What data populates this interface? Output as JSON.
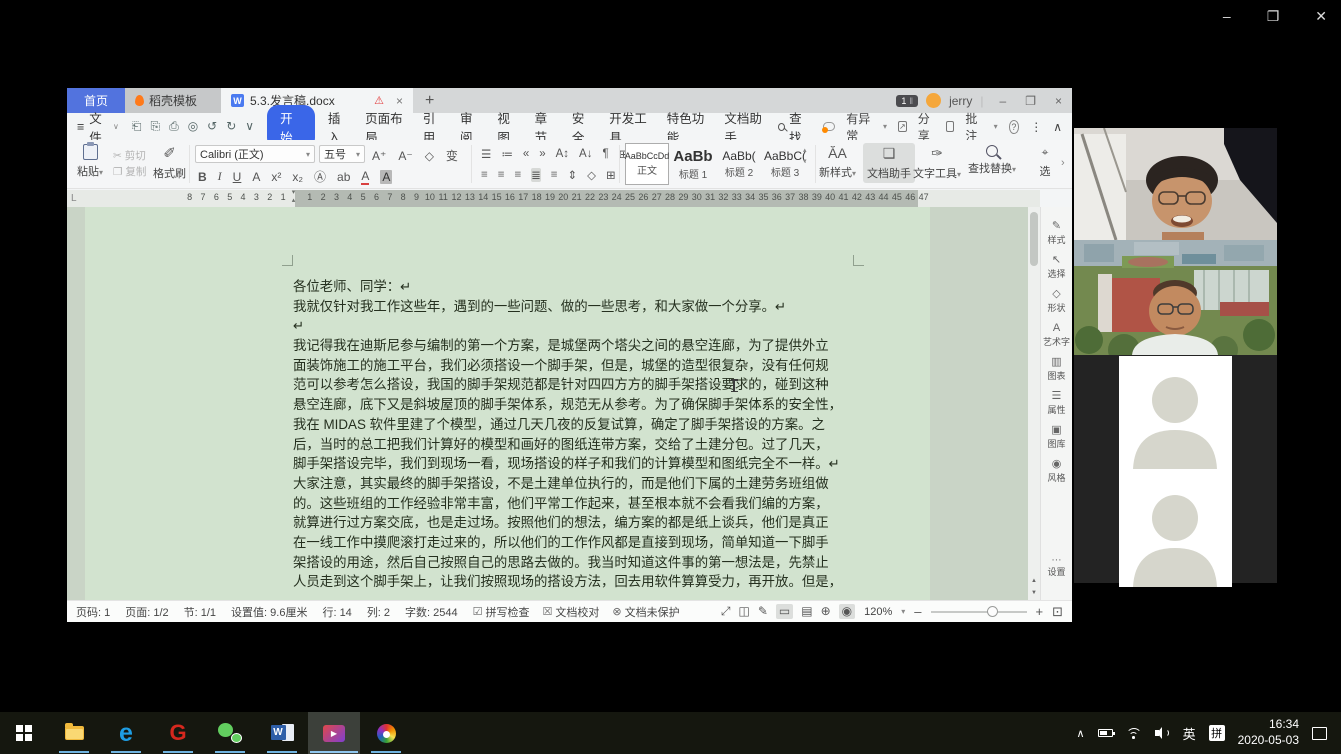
{
  "conference": {
    "controls": {
      "minimize": "–",
      "restore": "❐",
      "close": "✕"
    }
  },
  "ui": {
    "caret": "▾",
    "caret_small": "∨",
    "expand": "›",
    "bars": "‖",
    "play": "▶",
    "dots": "⋯",
    "more": "⋮",
    "collapse": "∧",
    "up": "▴",
    "down": "▾"
  },
  "wps": {
    "tab_bar": {
      "home": "首页",
      "template": "稻壳模板",
      "doc": "5.3.发言稿.docx",
      "warning": "⚠",
      "close_tab": "×",
      "new_tab": "+",
      "window_count": "1",
      "account": "jerry",
      "sep": "|",
      "minimize": "–",
      "restore": "❐",
      "close": "×"
    },
    "menu": {
      "hamburger": "≡",
      "file": "文件",
      "quick_icons": [
        "⎗",
        "⎘",
        "⎙",
        "◎",
        "↺",
        "↻",
        "∨"
      ],
      "home": "开始",
      "items": [
        "插入",
        "页面布局",
        "引用",
        "审阅",
        "视图",
        "章节",
        "安全",
        "开发工具",
        "特色功能",
        "文档助手"
      ],
      "find": "查找",
      "abnormal": "有异常",
      "share": "分享",
      "comment": "批注",
      "help": "?"
    },
    "ribbon": {
      "paste": "粘贴",
      "cut_icon": "✂",
      "cut": "剪切",
      "copy_icon": "❐",
      "copy": "复制",
      "fp_icon": "✐",
      "format_painter": "格式刷",
      "font_name": "Calibri (正文)",
      "font_size": "五号",
      "font_tools": [
        "A⁺",
        "A⁻",
        "◇",
        "变"
      ],
      "font_row": [
        "B",
        "I",
        "U",
        "A",
        "x²",
        "x₂",
        "Ⓐ",
        "ab",
        "A",
        "A"
      ],
      "para_row1": [
        "☰",
        "≔",
        "«",
        "»",
        "A↕",
        "A↓",
        "¶",
        "⊞"
      ],
      "para_row2": [
        "≡",
        "≡",
        "≡",
        "≣",
        "≡",
        "⇕",
        "◇",
        "⊞"
      ],
      "styles": [
        {
          "sample": "AaBbCcDd",
          "name": "正文"
        },
        {
          "sample": "AaBb",
          "name": "标题 1"
        },
        {
          "sample": "AaBb(",
          "name": "标题 2"
        },
        {
          "sample": "AaBbC(",
          "name": "标题 3"
        }
      ],
      "new_style_icon": "ĂA",
      "new_style": "新样式",
      "assistant_icon": "❏",
      "doc_assistant": "文档助手",
      "text_tool_icon": "✑",
      "text_tool": "文字工具",
      "find_replace": "查找替换",
      "select": "选"
    },
    "ruler": {
      "tab_selector": "L",
      "numbers": [
        "8",
        "7",
        "6",
        "5",
        "4",
        "3",
        "2",
        "1",
        "",
        "1",
        "2",
        "3",
        "4",
        "5",
        "6",
        "7",
        "8",
        "9",
        "10",
        "11",
        "12",
        "13",
        "14",
        "15",
        "16",
        "17",
        "18",
        "19",
        "20",
        "21",
        "22",
        "23",
        "24",
        "25",
        "26",
        "27",
        "28",
        "29",
        "30",
        "31",
        "32",
        "33",
        "34",
        "35",
        "36",
        "37",
        "38",
        "39",
        "40",
        "41",
        "42",
        "43",
        "44",
        "45",
        "46",
        "47"
      ]
    },
    "document": {
      "lines": [
        "各位老师、同学：↵",
        "我就仅针对我工作这些年，遇到的一些问题、做的一些思考，和大家做一个分享。↵",
        "↵",
        "我记得我在迪斯尼参与编制的第一个方案，是城堡两个塔尖之间的悬空连廊，为了提供外立",
        "面装饰施工的施工平台，我们必须搭设一个脚手架，但是，城堡的造型很复杂，没有任何规",
        "范可以参考怎么搭设，我国的脚手架规范都是针对四四方方的脚手架搭设要求的，碰到这种",
        "悬空连廊，底下又是斜坡屋顶的脚手架体系，规范无从参考。为了确保脚手架体系的安全性，",
        "我在 MIDAS 软件里建了个模型，通过几天几夜的反复试算，确定了脚手架搭设的方案。之",
        "后，当时的总工把我们计算好的模型和画好的图纸连带方案，交给了土建分包。过了几天，",
        "脚手架搭设完毕，我们到现场一看，现场搭设的样子和我们的计算模型和图纸完全不一样。↵",
        "大家注意，其实最终的脚手架搭设，不是土建单位执行的，而是他们下属的土建劳务班组做",
        "的。这些班组的工作经验非常丰富，他们平常工作起来，甚至根本就不会看我们编的方案，",
        "就算进行过方案交底，也是走过场。按照他们的想法，编方案的都是纸上谈兵，他们是真正",
        "在一线工作中摸爬滚打走过来的，所以他们的工作作风都是直接到现场，简单知道一下脚手",
        "架搭设的用途，然后自己按照自己的思路去做的。我当时知道这件事的第一想法是，先禁止",
        "人员走到这个脚手架上，让我们按照现场的搭设方法，回去用软件算算受力，再开放。但是，"
      ]
    },
    "status_bar": {
      "items": [
        "页码: 1",
        "页面: 1/2",
        "节: 1/1",
        "设置值: 9.6厘米",
        "行: 14",
        "列: 2",
        "字数: 2544"
      ],
      "checks": [
        {
          "icon": "☑",
          "label": "拼写检查"
        },
        {
          "icon": "☒",
          "label": "文档校对"
        },
        {
          "icon": "⊗",
          "label": "文档未保护"
        }
      ],
      "view_icons": [
        "⤢",
        "◫",
        "✎",
        "▭",
        "▤",
        "⊕",
        "◉"
      ],
      "zoom": "120%",
      "zoom_out": "–",
      "zoom_in": "+",
      "fit": "⊡"
    },
    "sidebar": {
      "items": [
        {
          "icon": "✎",
          "label": "样式"
        },
        {
          "icon": "↖",
          "label": "选择"
        },
        {
          "icon": "◇",
          "label": "形状"
        },
        {
          "icon": "A",
          "label": "艺术字"
        },
        {
          "icon": "▥",
          "label": "图表"
        },
        {
          "icon": "☰",
          "label": "属性"
        },
        {
          "icon": "▣",
          "label": "图库"
        },
        {
          "icon": "◉",
          "label": "风格"
        }
      ],
      "settings": "设置"
    }
  },
  "taskbar": {
    "glyphs": {
      "edge": "e",
      "g": "G",
      "word": "W"
    },
    "tray": {
      "collapse": "∧",
      "lang": "英",
      "ime": "拼",
      "time": "16:34",
      "date": "2020-05-03"
    }
  },
  "colors": {
    "wps_blue": "#3a66e8",
    "eye_protect_green": "#d2e3cf",
    "wps_orange": "#ff7a1a",
    "taskbar_underline": "#6fb3e0"
  }
}
